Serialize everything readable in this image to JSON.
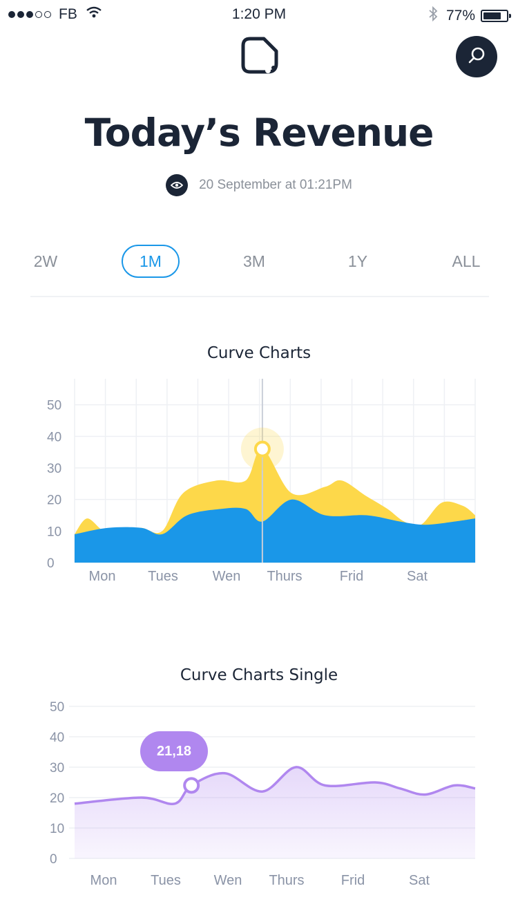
{
  "status_bar": {
    "carrier": "FB",
    "time": "1:20 PM",
    "battery": "77%",
    "battery_level": 0.77
  },
  "header": {
    "logo_icon": "note-icon",
    "search_icon": "search-icon",
    "title": "Today’s Revenue",
    "timestamp": "20 September at 01:21PM"
  },
  "range_tabs": [
    "2W",
    "1M",
    "3M",
    "1Y",
    "ALL"
  ],
  "active_tab": "1M",
  "colors": {
    "navy": "#1b2536",
    "blue": "#1a97e8",
    "yellow": "#fdd84a",
    "purple": "#b087ef",
    "grid": "#eef0f4",
    "axis_text": "#8a93a6"
  },
  "chart_data": [
    {
      "type": "area",
      "title": "Curve Charts",
      "categories": [
        "Mon",
        "Tues",
        "Wen",
        "Thurs",
        "Frid",
        "Sat"
      ],
      "yticks": [
        0,
        10,
        20,
        30,
        40,
        50
      ],
      "ylim": [
        0,
        60
      ],
      "grid": true,
      "highlight": {
        "series": 0,
        "x": 4.5,
        "y": 36
      },
      "series": [
        {
          "color": "#fdd84a",
          "points": [
            [
              0,
              9
            ],
            [
              0.3,
              14
            ],
            [
              0.7,
              10
            ],
            [
              1,
              11
            ],
            [
              1.6,
              11
            ],
            [
              2.1,
              10
            ],
            [
              2.6,
              22
            ],
            [
              3.4,
              26
            ],
            [
              4.1,
              26
            ],
            [
              4.5,
              36
            ],
            [
              5.2,
              22
            ],
            [
              6,
              24
            ],
            [
              6.4,
              26
            ],
            [
              7,
              21
            ],
            [
              7.5,
              17
            ],
            [
              7.9,
              13
            ],
            [
              8.3,
              12
            ],
            [
              8.8,
              19
            ],
            [
              9.3,
              18
            ],
            [
              9.6,
              15
            ]
          ]
        },
        {
          "color": "#1a97e8",
          "points": [
            [
              0,
              9
            ],
            [
              0.8,
              11
            ],
            [
              1.6,
              11
            ],
            [
              2.1,
              9
            ],
            [
              2.7,
              15
            ],
            [
              3.5,
              17
            ],
            [
              4.1,
              17
            ],
            [
              4.5,
              13
            ],
            [
              5.2,
              20
            ],
            [
              6,
              15
            ],
            [
              7,
              15
            ],
            [
              7.8,
              13
            ],
            [
              8.4,
              12
            ],
            [
              9.1,
              13
            ],
            [
              9.6,
              14
            ]
          ]
        }
      ]
    },
    {
      "type": "area",
      "title": "Curve Charts Single",
      "categories": [
        "Mon",
        "Tues",
        "Wen",
        "Thurs",
        "Frid",
        "Sat"
      ],
      "yticks": [
        0,
        10,
        20,
        30,
        40,
        50
      ],
      "ylim": [
        0,
        50
      ],
      "grid": true,
      "tooltip": "21,18",
      "highlight": {
        "series": 0,
        "x": 2.8,
        "y": 24
      },
      "series": [
        {
          "color": "#b087ef",
          "points": [
            [
              0,
              18
            ],
            [
              1.6,
              20
            ],
            [
              2.4,
              18
            ],
            [
              2.8,
              24
            ],
            [
              3.6,
              28
            ],
            [
              4.5,
              22
            ],
            [
              5.3,
              30
            ],
            [
              6,
              24
            ],
            [
              7.2,
              25
            ],
            [
              7.8,
              23
            ],
            [
              8.4,
              21
            ],
            [
              9.1,
              24
            ],
            [
              9.6,
              23
            ]
          ]
        }
      ]
    }
  ]
}
